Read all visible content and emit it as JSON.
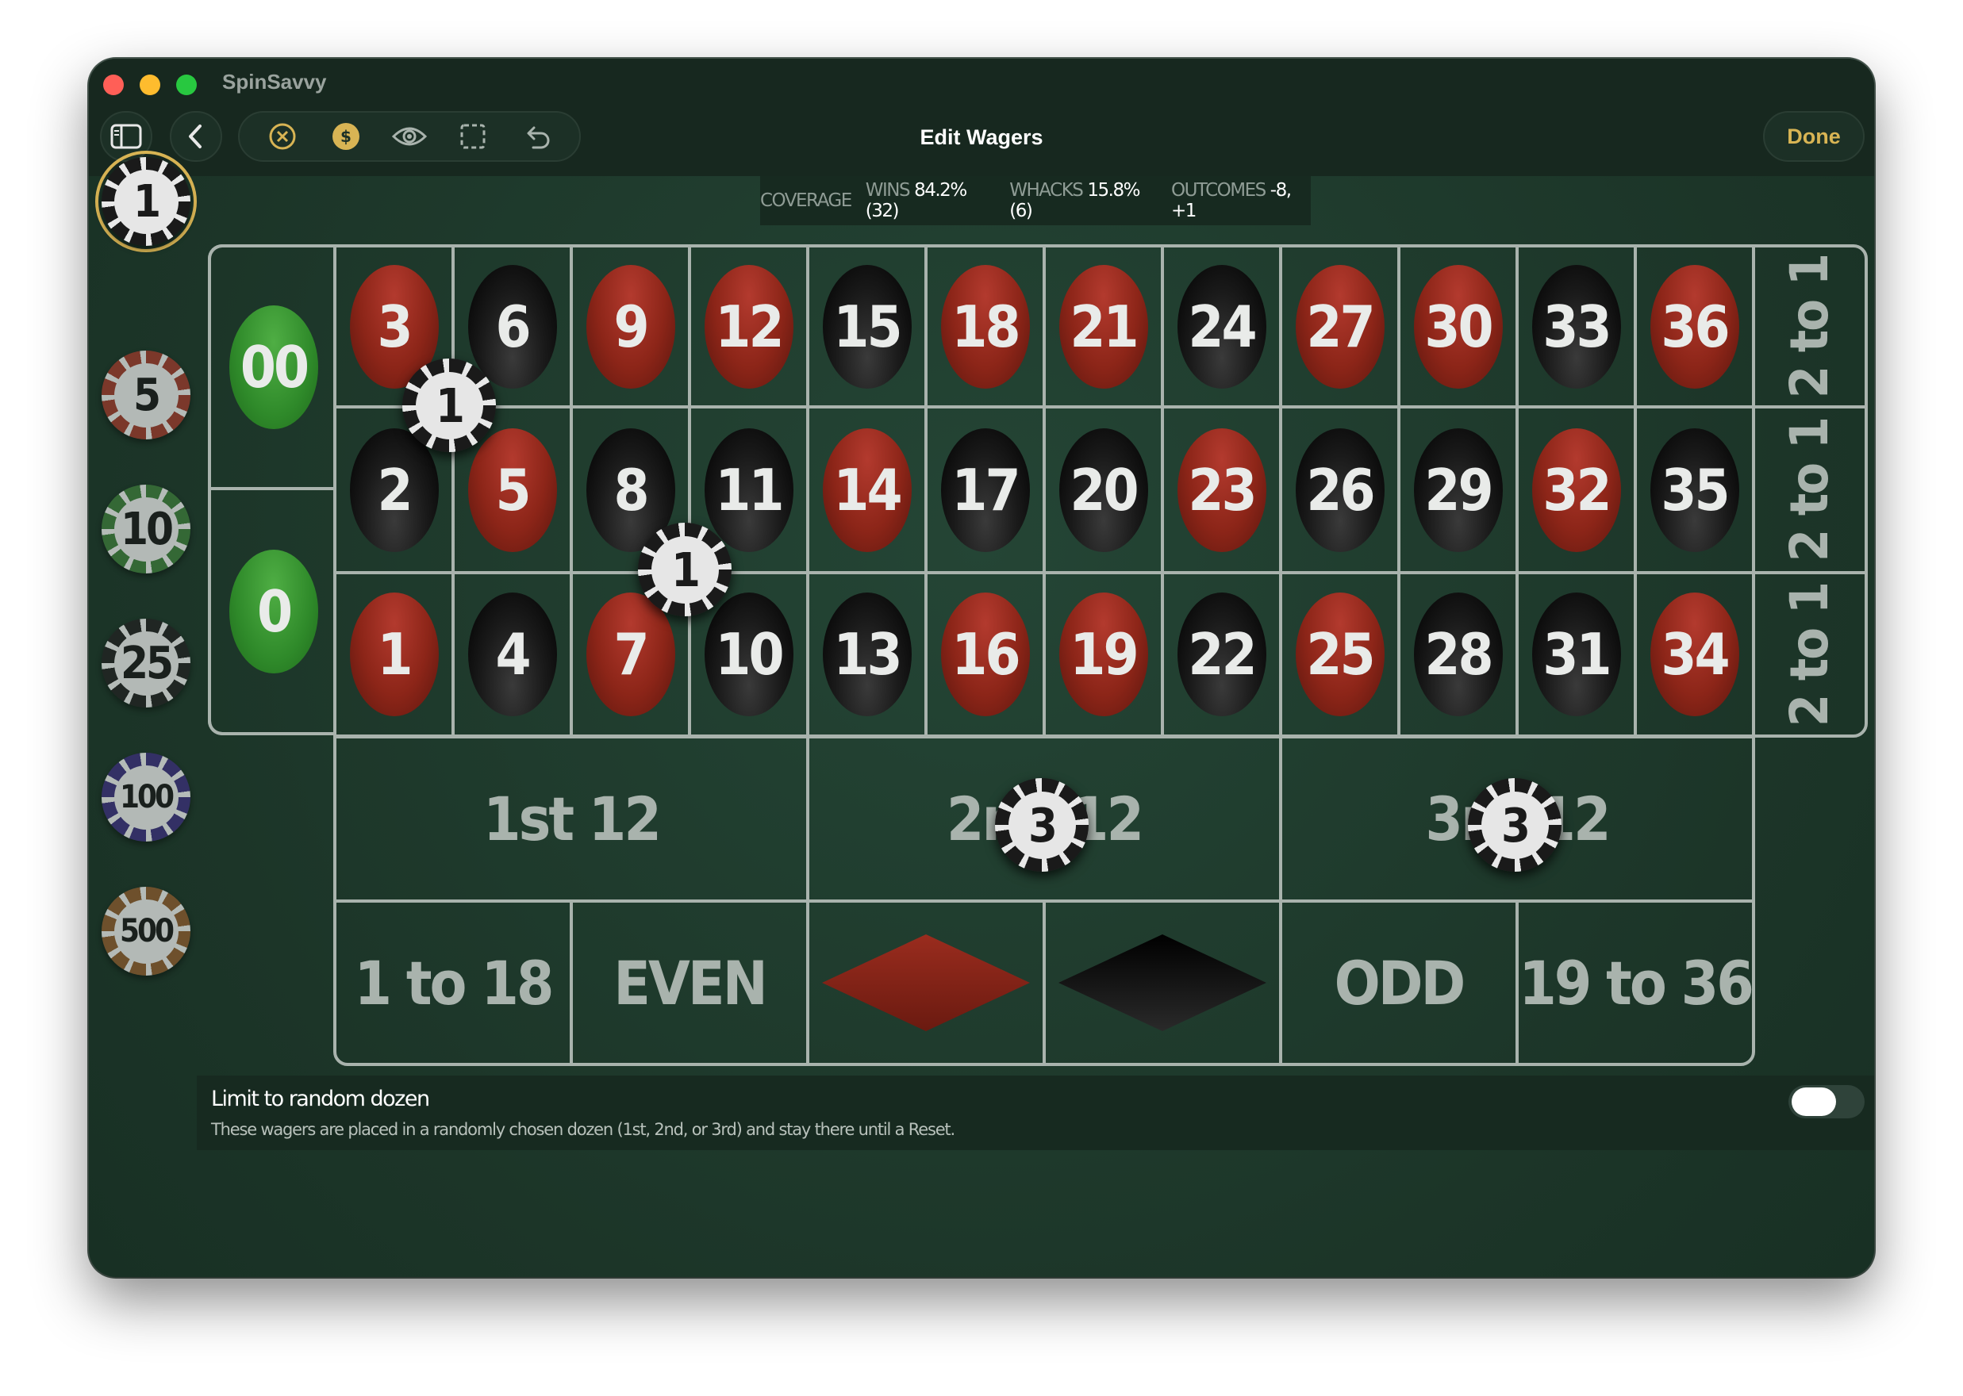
{
  "app": {
    "name": "SpinSavvy"
  },
  "toolbar": {
    "title": "Edit Wagers",
    "done_label": "Done",
    "icons": [
      "sidebar-icon",
      "back-icon",
      "clear-icon",
      "dollar-icon",
      "eye-icon",
      "selection-icon",
      "undo-icon"
    ]
  },
  "stats": {
    "coverage_label": "COVERAGE",
    "wins_label": "WINS",
    "wins_value": "84.2% (32)",
    "whacks_label": "WHACKS",
    "whacks_value": "15.8% (6)",
    "outcomes_label": "OUTCOMES",
    "outcomes_value": "-8, +1"
  },
  "chip_rack": [
    {
      "value": "1",
      "selected": true,
      "edge": "#1a1a1a"
    },
    {
      "value": "5",
      "selected": false,
      "edge": "#9b3a2c"
    },
    {
      "value": "10",
      "selected": false,
      "edge": "#3d7a3a"
    },
    {
      "value": "25",
      "selected": false,
      "edge": "#222222"
    },
    {
      "value": "100",
      "selected": false,
      "edge": "#3b2f7a"
    },
    {
      "value": "500",
      "selected": false,
      "edge": "#8a5a2e"
    }
  ],
  "zeros": [
    "00",
    "0"
  ],
  "numbers": {
    "top_row": [
      "3",
      "6",
      "9",
      "12",
      "15",
      "18",
      "21",
      "24",
      "27",
      "30",
      "33",
      "36"
    ],
    "middle_row": [
      "2",
      "5",
      "8",
      "11",
      "14",
      "17",
      "20",
      "23",
      "26",
      "29",
      "32",
      "35"
    ],
    "bottom_row": [
      "1",
      "4",
      "7",
      "10",
      "13",
      "16",
      "19",
      "22",
      "25",
      "28",
      "31",
      "34"
    ],
    "red": [
      "1",
      "3",
      "5",
      "7",
      "9",
      "12",
      "14",
      "16",
      "18",
      "19",
      "21",
      "23",
      "25",
      "27",
      "30",
      "32",
      "34",
      "36"
    ]
  },
  "columns": [
    "2 to 1",
    "2 to 1",
    "2 to 1"
  ],
  "dozens": [
    "1st 12",
    "2nd 12",
    "3rd 12"
  ],
  "even_money": [
    "1 to 18",
    "EVEN",
    "",
    "",
    "ODD",
    "19 to 36"
  ],
  "even_money_names": [
    "low-bet",
    "even-bet",
    "red-bet",
    "black-bet",
    "odd-bet",
    "high-bet"
  ],
  "placed_wagers": [
    {
      "value": "1",
      "spot": "split 3-2 / 6-5 corner"
    },
    {
      "value": "1",
      "spot": "corner 8-7-11-10"
    },
    {
      "value": "3",
      "spot": "2nd 12"
    },
    {
      "value": "3",
      "spot": "3rd 12"
    }
  ],
  "limit": {
    "title": "Limit to random dozen",
    "description": "These wagers are placed in a randomly chosen dozen (1st, 2nd, or 3rd) and stay there until a Reset.",
    "enabled": false
  },
  "colors": {
    "felt": "#1f3a2c",
    "accent": "#d8b454",
    "red": "#8c2518",
    "green": "#2f8a2a",
    "lines": "#a9b3ad"
  }
}
